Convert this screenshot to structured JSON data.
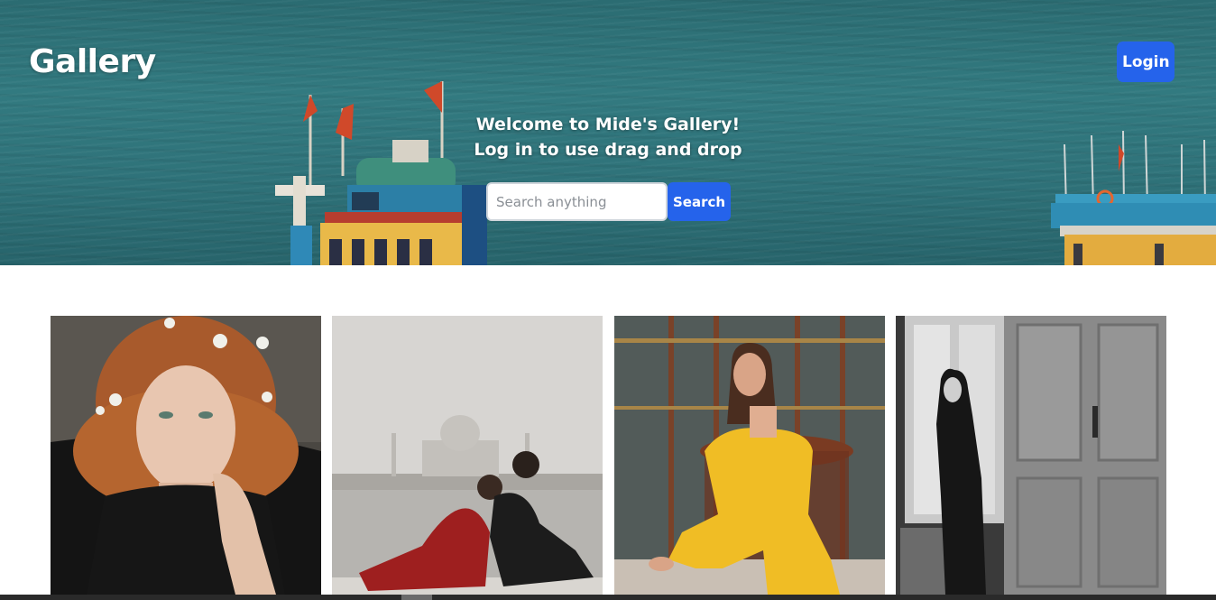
{
  "header": {
    "brand": "Gallery",
    "login_label": "Login"
  },
  "hero": {
    "welcome_line1": "Welcome to Mide's Gallery!",
    "welcome_line2": "Log in to use drag and drop",
    "search_placeholder": "Search anything",
    "search_value": "",
    "search_button_label": "Search"
  },
  "gallery": {
    "photos": [
      {
        "subject": "curly-haired-man-with-flowers"
      },
      {
        "subject": "couple-sitting-before-taj-mahal"
      },
      {
        "subject": "woman-in-yellow-suit"
      },
      {
        "subject": "woman-by-window-black-and-white"
      }
    ]
  },
  "colors": {
    "accent": "#2563eb",
    "hero_water": "#2f737a",
    "text_light": "#ffffff"
  }
}
